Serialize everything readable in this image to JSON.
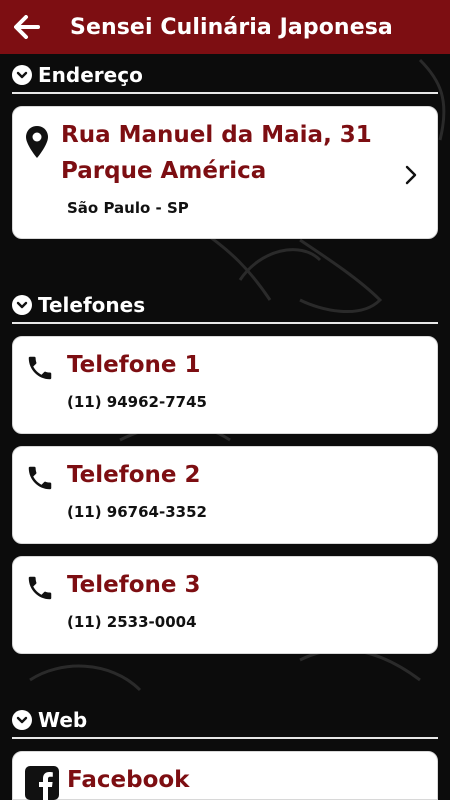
{
  "app": {
    "title": "Sensei Culinária Japonesa"
  },
  "colors": {
    "brand": "#7d0e12",
    "background": "#0c0c0c",
    "card": "#ffffff"
  },
  "address_section": {
    "title": "Endereço",
    "line1": "Rua Manuel da Maia, 31",
    "line2": "Parque América",
    "city": "São Paulo - SP",
    "icon": "map-pin-icon"
  },
  "phones_section": {
    "title": "Telefones",
    "items": [
      {
        "label": "Telefone 1",
        "number": "(11) 94962-7745"
      },
      {
        "label": "Telefone 2",
        "number": "(11) 96764-3352"
      },
      {
        "label": "Telefone 3",
        "number": "(11) 2533-0004"
      }
    ]
  },
  "web_section": {
    "title": "Web",
    "items": [
      {
        "label": "Facebook",
        "icon": "facebook-icon"
      }
    ]
  }
}
